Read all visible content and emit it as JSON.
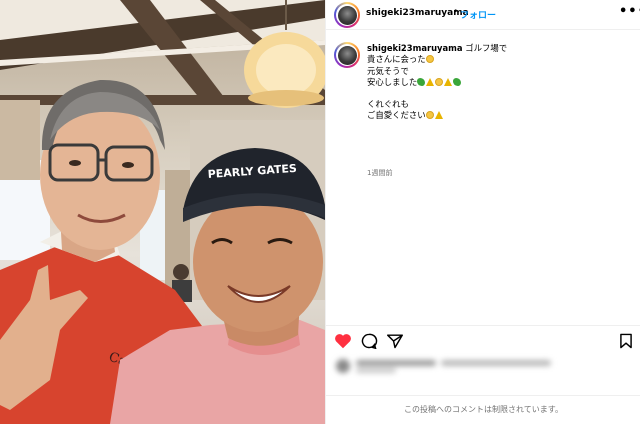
{
  "post": {
    "username": "shigeki23maruyama",
    "separator": "•",
    "follow_label": "フォロー",
    "more_icon": "more-horizontal-icon"
  },
  "caption": {
    "username": "shigeki23maruyama",
    "line1": "ゴルフ場で",
    "line2": "貴さんに会った",
    "line3": "元気そうで",
    "line4": "安心しました",
    "line5": "くれぐれも",
    "line6": "ご自愛ください",
    "time": "1週間前"
  },
  "photo": {
    "cap_text": "PEARLY GATES",
    "sweater_text": "Callaway"
  },
  "actions": {
    "like_icon": "heart-filled-icon",
    "like_color": "#ff3040",
    "comment_icon": "comment-icon",
    "share_icon": "share-icon",
    "save_icon": "bookmark-icon"
  },
  "comments": {
    "restricted_text": "この投稿へのコメントは制限されています。"
  }
}
